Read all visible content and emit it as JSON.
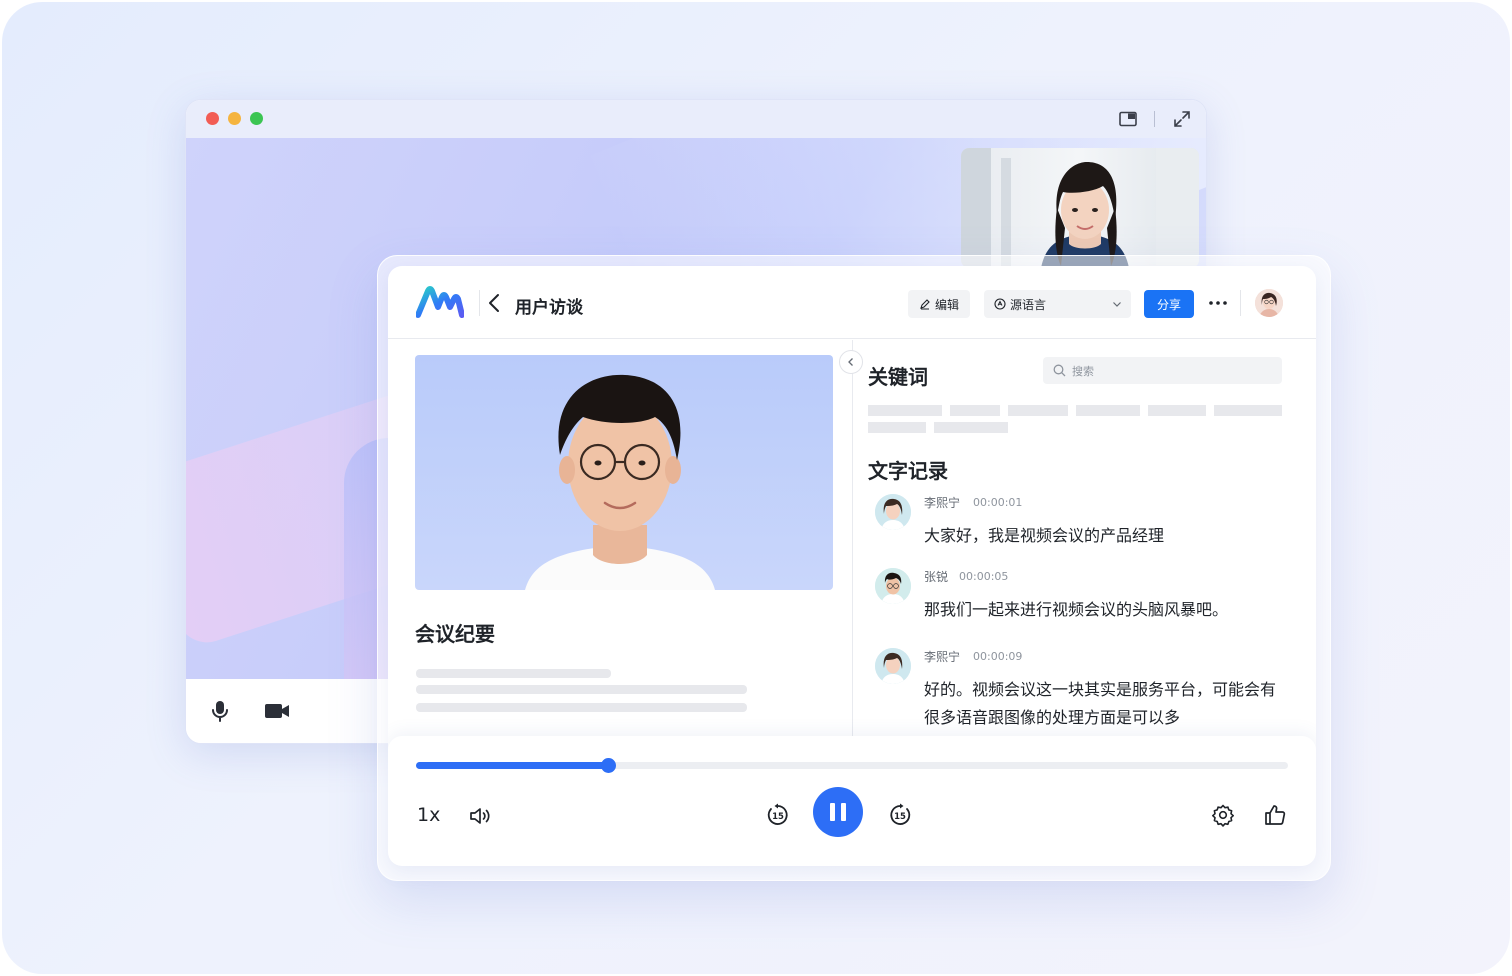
{
  "app": {
    "title": "用户访谈",
    "toolbar": {
      "edit_label": "编辑",
      "language_label": "源语言",
      "share_label": "分享"
    }
  },
  "left": {
    "summary_title": "会议纪要"
  },
  "right": {
    "keywords_title": "关键词",
    "search_placeholder": "搜索",
    "transcript_title": "文字记录",
    "entries": [
      {
        "speaker": "李熙宁",
        "time": "00:00:01",
        "text": "大家好，我是视频会议的产品经理"
      },
      {
        "speaker": "张锐",
        "time": "00:00:05",
        "text": "那我们一起来进行视频会议的头脑风暴吧。"
      },
      {
        "speaker": "李熙宁",
        "time": "00:00:09",
        "text": "好的。视频会议这一块其实是服务平台，可能会有很多语音跟图像的处理方面是可以多"
      }
    ]
  },
  "player": {
    "speed": "1x",
    "progress": 0.22,
    "skip_back": "15",
    "skip_forward": "15",
    "accent": "#2d6ef6"
  },
  "icons": [
    "pip-icon",
    "fullscreen-icon",
    "microphone-icon",
    "camera-icon",
    "back-icon",
    "edit-icon",
    "translate-icon",
    "chevron-down-icon",
    "more-icon",
    "search-icon",
    "volume-icon",
    "rewind-15-icon",
    "pause-icon",
    "forward-15-icon",
    "settings-icon",
    "thumbs-up-icon"
  ]
}
